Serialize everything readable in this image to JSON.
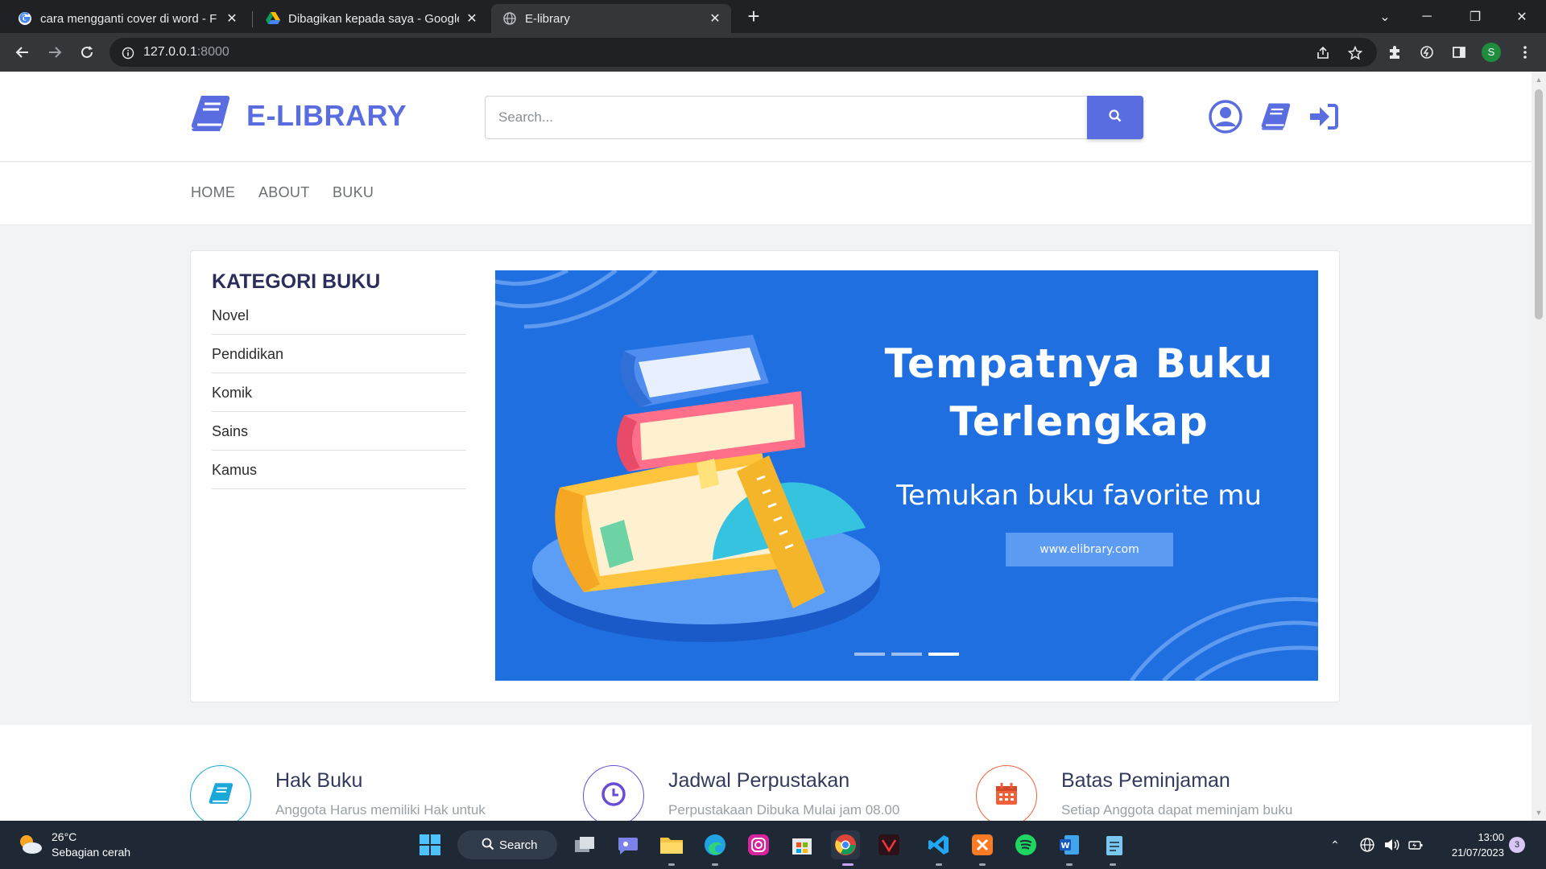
{
  "browser": {
    "tabs": [
      {
        "title": "cara mengganti cover di word - F",
        "favicon": "google-icon",
        "active": false
      },
      {
        "title": "Dibagikan kepada saya - Google",
        "favicon": "google-drive-icon",
        "active": false
      },
      {
        "title": "E-library",
        "favicon": "globe-icon",
        "active": true
      }
    ],
    "address": {
      "host": "127.0.0.1",
      "port": ":8000"
    },
    "profile_initial": "S"
  },
  "site": {
    "logo_text": "E-LIBRARY",
    "brand_color": "#5a6de0",
    "search_placeholder": "Search...",
    "nav": [
      "HOME",
      "ABOUT",
      "BUKU"
    ],
    "categories_title": "KATEGORI BUKU",
    "categories": [
      "Novel",
      "Pendidikan",
      "Komik",
      "Sains",
      "Kamus"
    ],
    "banner": {
      "heading_line1": "Tempatnya Buku",
      "heading_line2": "Terlengkap",
      "subheading": "Temukan buku favorite mu",
      "url": "www.elibrary.com",
      "background": "#1f6fe0",
      "slides": 3,
      "active_slide": 3
    },
    "features": [
      {
        "title": "Hak Buku",
        "text": "Anggota Harus memiliki Hak untuk",
        "icon": "book-icon",
        "color": "#1aa8d8"
      },
      {
        "title": "Jadwal Perpustakan",
        "text": "Perpustakaan Dibuka Mulai jam 08.00",
        "icon": "clock-icon",
        "color": "#6a4bd6"
      },
      {
        "title": "Batas Peminjaman",
        "text": "Setiap Anggota dapat meminjam buku",
        "icon": "calendar-icon",
        "color": "#f0603a"
      }
    ]
  },
  "taskbar": {
    "weather_temp": "26°C",
    "weather_desc": "Sebagian cerah",
    "search_label": "Search",
    "time": "13:00",
    "date": "21/07/2023",
    "notifications": "3"
  }
}
